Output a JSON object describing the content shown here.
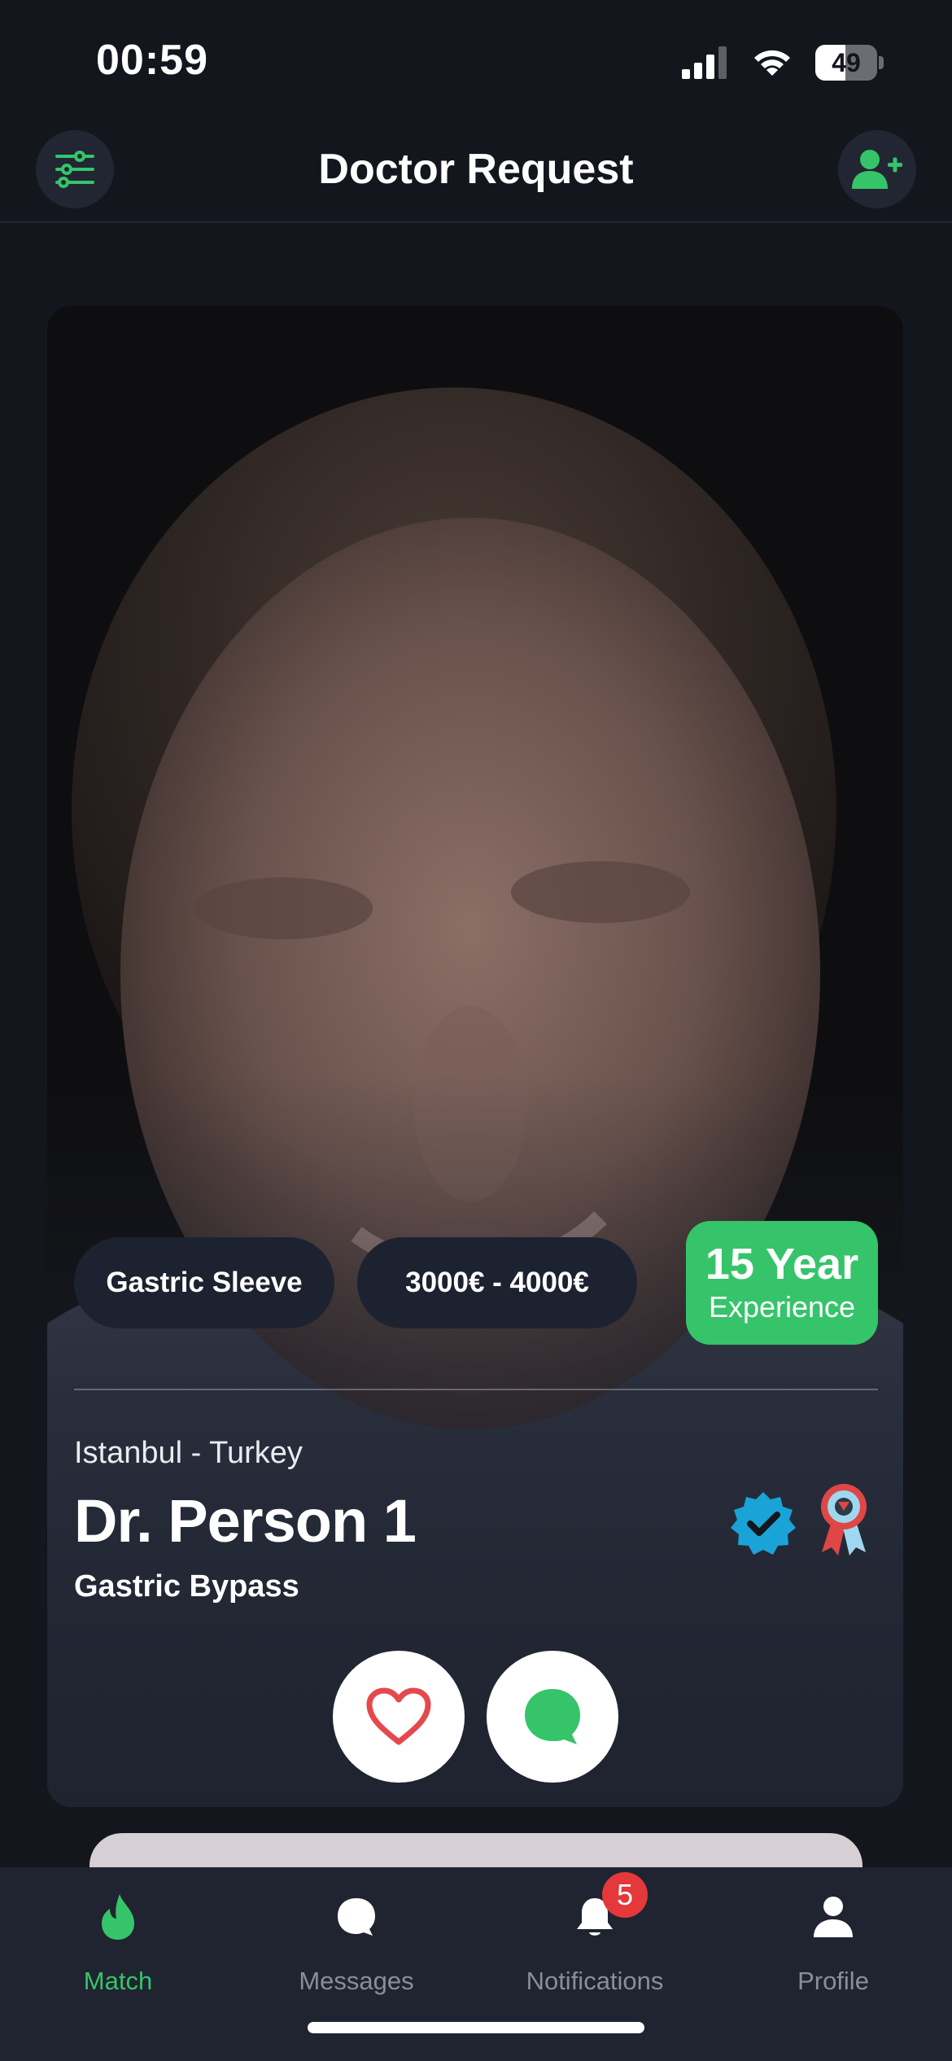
{
  "status_bar": {
    "time": "00:59",
    "battery_level": "49",
    "battery_fraction": 0.49
  },
  "header": {
    "title": "Doctor Request",
    "left_icon": "filter-sliders-icon",
    "right_icon": "add-user-icon"
  },
  "card": {
    "procedure_tag": "Gastric Sleeve",
    "price_tag": "3000€ - 4000€",
    "experience": {
      "years": "15 Year",
      "label": "Experience"
    },
    "location": "Istanbul - Turkey",
    "name": "Dr. Person 1",
    "specialty": "Gastric Bypass",
    "badges": [
      "verified-badge-icon",
      "award-ribbon-icon"
    ],
    "actions": [
      "heart-icon",
      "chat-bubble-icon"
    ]
  },
  "tabs": [
    {
      "label": "Match",
      "icon": "flame-icon",
      "active": true
    },
    {
      "label": "Messages",
      "icon": "chat-icon",
      "active": false
    },
    {
      "label": "Notifications",
      "icon": "bell-icon",
      "active": false,
      "badge": "5"
    },
    {
      "label": "Profile",
      "icon": "person-icon",
      "active": false
    }
  ],
  "colors": {
    "accent": "#36c46a",
    "background": "#13161d",
    "tab_bar": "#1f2430",
    "like": "#e5484d",
    "badge": "#e5383b",
    "verified": "#1aa3d6"
  }
}
